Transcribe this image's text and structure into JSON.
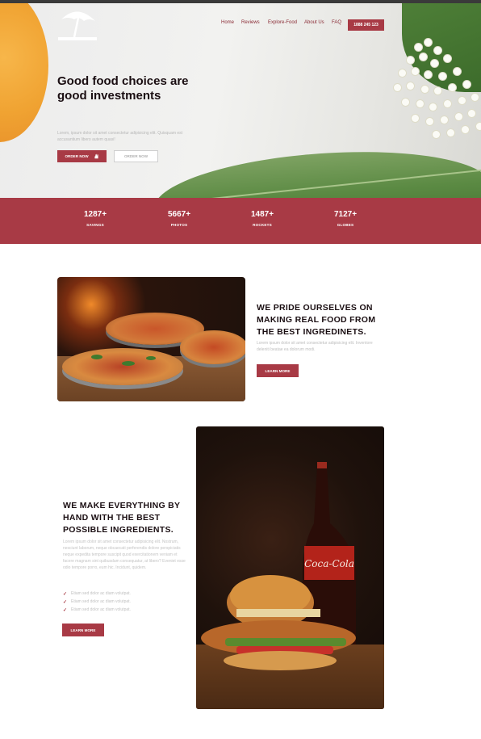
{
  "nav": {
    "items": [
      {
        "label": "Home"
      },
      {
        "label": "Reviews"
      },
      {
        "label": "Explore-Food"
      },
      {
        "label": "About Us"
      },
      {
        "label": "FAQ"
      }
    ],
    "phone_label": "1888 245 123"
  },
  "hero": {
    "title": "Good food choices are good investments",
    "subtitle": "Lorem, ipsum dolor sit amet consectetur adipisicing elit. Quisquam est accusantium libero autem quasi!",
    "primary_button": "ORDER NOW",
    "secondary_button": "ORDER NOW"
  },
  "stats": [
    {
      "value": "1287+",
      "label": "SAVINGS"
    },
    {
      "value": "5667+",
      "label": "PHOTOS"
    },
    {
      "value": "1487+",
      "label": "ROCKETS"
    },
    {
      "value": "7127+",
      "label": "GLOBES"
    }
  ],
  "section1": {
    "title": "WE PRIDE OURSELVES ON MAKING REAL FOOD FROM THE BEST INGREDINETS.",
    "text": "Lorem ipsum dolor sit amet consectetur adipisicing elit. Inventore deleniti beatae ea dolorum modi.",
    "button": "LEARN MORE"
  },
  "section2": {
    "title": "WE MAKE EVERYTHING BY HAND WITH THE BEST POSSIBLE INGREDIENTS.",
    "text": "Lorem ipsum dolor sit amet consectetur adipisicing elit. Nostrum, nesciunt laborum, neque obcaecati perferendis dolore perspiciatis neque expedita tempore suscipit quod exercitationem veniam et facere magnam sint quibusdam consequatur, at libero? Eveniet esse odio tempore porro, eum hic. Incidunt, quidem.",
    "checklist": [
      {
        "label": "Etiam sed dolor ac diam volutpat."
      },
      {
        "label": "Etiam sed dolor ac diam volutpat."
      },
      {
        "label": "Etiam sed dolor ac diam volutpat."
      }
    ],
    "button": "LEARN MORE"
  },
  "photo_labels": {
    "bottle_brand": "Coca-Cola"
  },
  "colors": {
    "accent": "#a83a45",
    "heading": "#1a0e12"
  }
}
